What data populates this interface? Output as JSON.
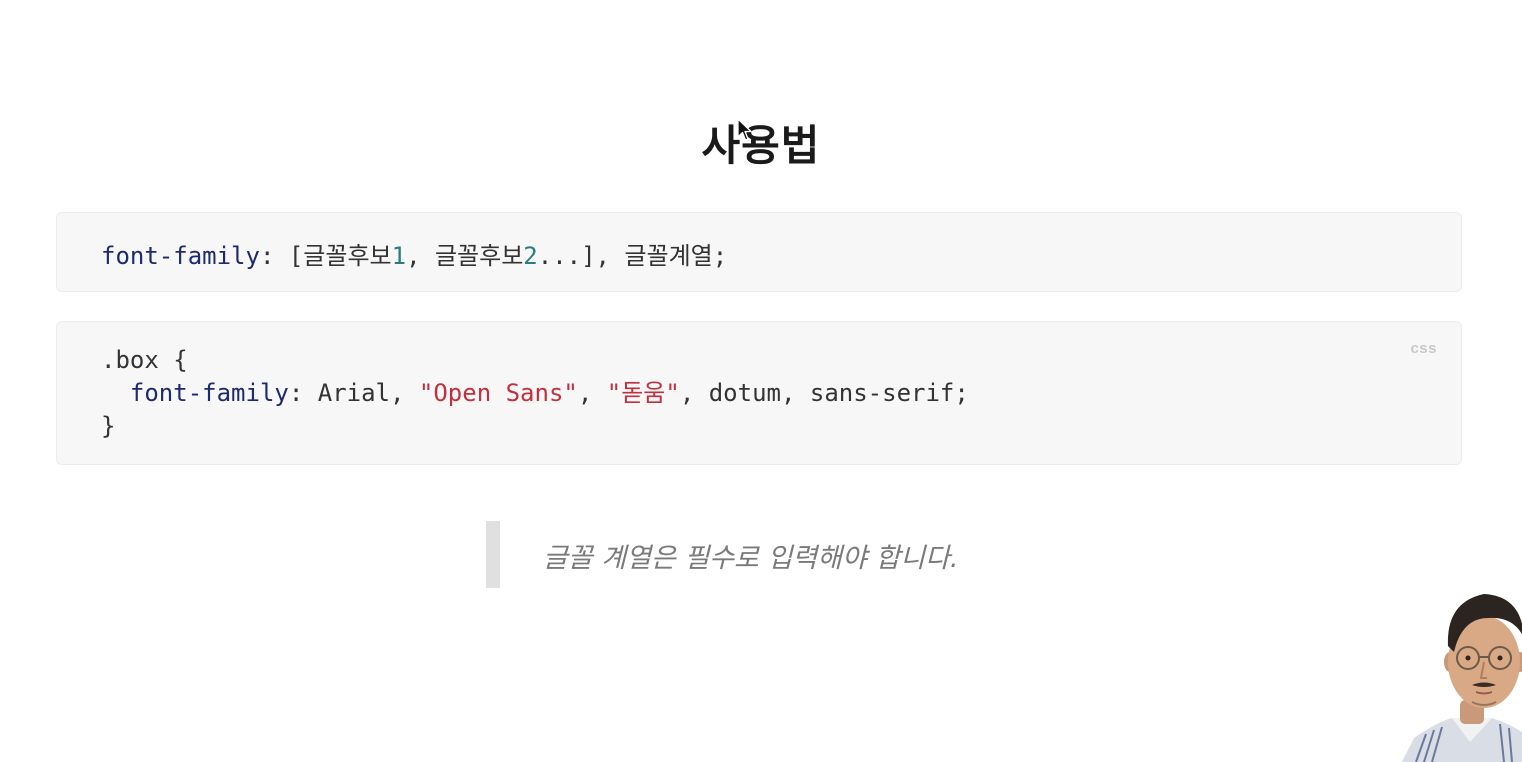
{
  "slide": {
    "title": "사용법"
  },
  "syntax_block": {
    "prop": "font-family",
    "sep1": ": [글꼴후보",
    "num1": "1",
    "sep2": ", 글꼴후보",
    "num2": "2",
    "rest": "...], 글꼴계열;"
  },
  "example_block": {
    "lang": "css",
    "line1": ".box {",
    "indent": "  ",
    "prop": "font-family",
    "part1": ": Arial, ",
    "str1": "\"Open Sans\"",
    "part2": ", ",
    "str2": "\"돋움\"",
    "part3": ", dotum, sans-serif;",
    "line3": "}"
  },
  "note": {
    "text": "글꼴 계열은 필수로 입력해야 합니다."
  },
  "colors": {
    "property": "#1d2a6e",
    "number": "#2a7d7a",
    "string": "#c2303e",
    "code_bg": "#f7f7f7",
    "quote_text": "#7a7a7a"
  },
  "icons": {
    "cursor": "mouse-pointer-icon",
    "presenter": "presenter-video-thumbnail"
  }
}
